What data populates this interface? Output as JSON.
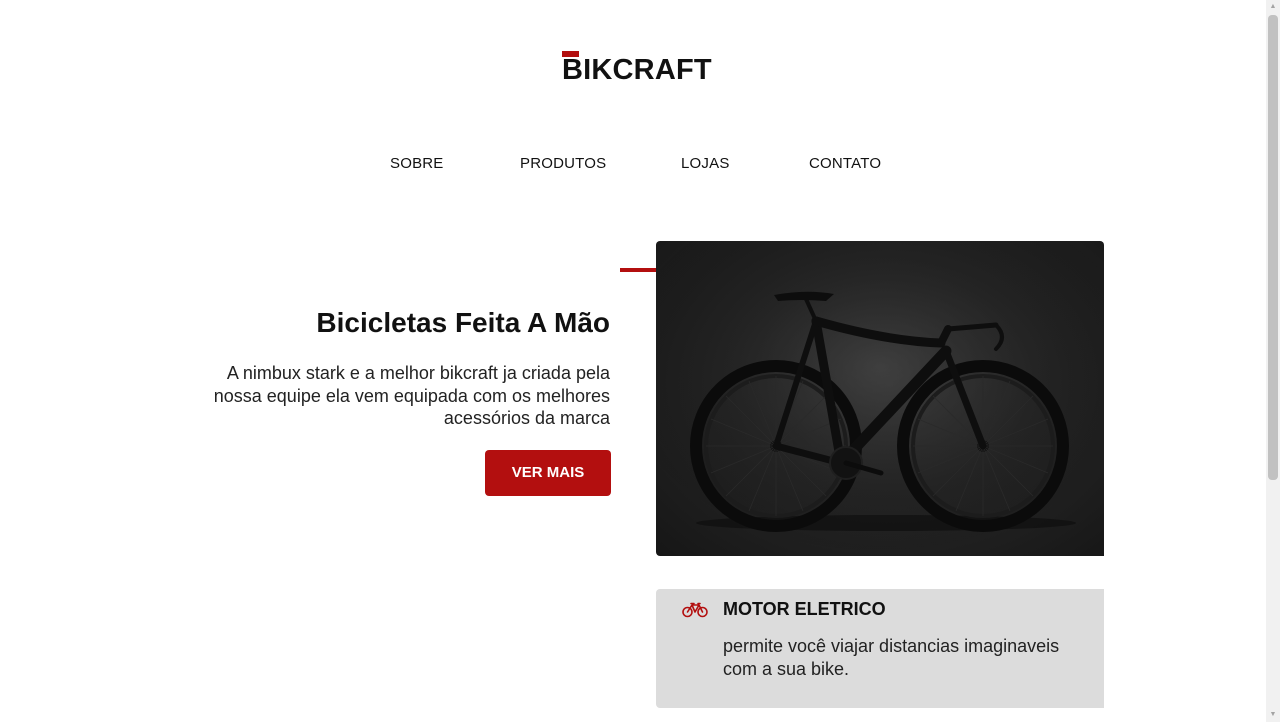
{
  "logo": {
    "text": "BIKCRAFT",
    "accent_color": "#b30f0f"
  },
  "nav": {
    "items": [
      {
        "label": "SOBRE"
      },
      {
        "label": "PRODUTOS"
      },
      {
        "label": "LOJAS"
      },
      {
        "label": "CONTATO"
      }
    ]
  },
  "hero": {
    "title": "Bicicletas Feita A Mão",
    "description": "A nimbux stark e a melhor bikcraft ja criada pela nossa equipe ela vem equipada com os melhores acessórios da marca",
    "button_label": "VER MAIS",
    "image_icon": "road-bicycle-photo",
    "accent_color": "#b30f0f"
  },
  "feature": {
    "icon": "bicycle-icon",
    "title": "MOTOR ELETRICO",
    "description": "permite você viajar distancias imaginaveis com a sua bike.",
    "background_color": "#dcdcdc"
  },
  "scrollbar": {
    "up_icon": "▲",
    "down_icon": "▼"
  }
}
